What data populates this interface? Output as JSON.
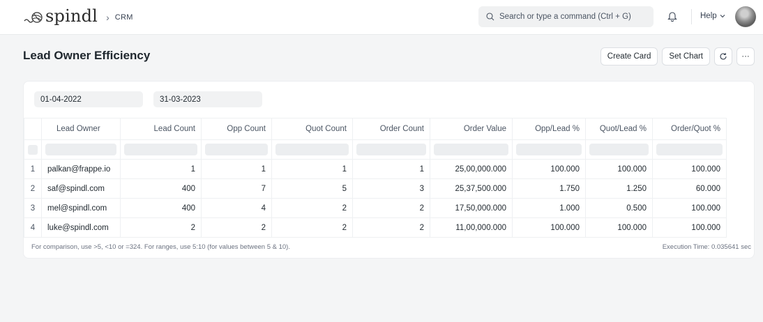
{
  "navbar": {
    "logo_text": "spindl",
    "breadcrumb": "CRM",
    "search_placeholder": "Search or type a command (Ctrl + G)",
    "help_label": "Help"
  },
  "page": {
    "title": "Lead Owner Efficiency",
    "actions": {
      "create_card": "Create Card",
      "set_chart": "Set Chart",
      "refresh_icon": "refresh-icon",
      "more_label": "···"
    }
  },
  "filters": {
    "from_date": "01-04-2022",
    "to_date": "31-03-2023"
  },
  "table": {
    "columns": [
      "Lead Owner",
      "Lead Count",
      "Opp Count",
      "Quot Count",
      "Order Count",
      "Order Value",
      "Opp/Lead %",
      "Quot/Lead %",
      "Order/Quot %"
    ],
    "rows": [
      {
        "idx": "1",
        "cells": [
          "palkan@frappe.io",
          "1",
          "1",
          "1",
          "1",
          "25,00,000.000",
          "100.000",
          "100.000",
          "100.000"
        ]
      },
      {
        "idx": "2",
        "cells": [
          "saf@spindl.com",
          "400",
          "7",
          "5",
          "3",
          "25,37,500.000",
          "1.750",
          "1.250",
          "60.000"
        ]
      },
      {
        "idx": "3",
        "cells": [
          "mel@spindl.com",
          "400",
          "4",
          "2",
          "2",
          "17,50,000.000",
          "1.000",
          "0.500",
          "100.000"
        ]
      },
      {
        "idx": "4",
        "cells": [
          "luke@spindl.com",
          "2",
          "2",
          "2",
          "2",
          "11,00,000.000",
          "100.000",
          "100.000",
          "100.000"
        ]
      }
    ]
  },
  "footer": {
    "note": "For comparison, use >5, <10 or =324. For ranges, use 5:10 (for values between 5 & 10).",
    "execution_time": "Execution Time: 0.035641 sec"
  }
}
